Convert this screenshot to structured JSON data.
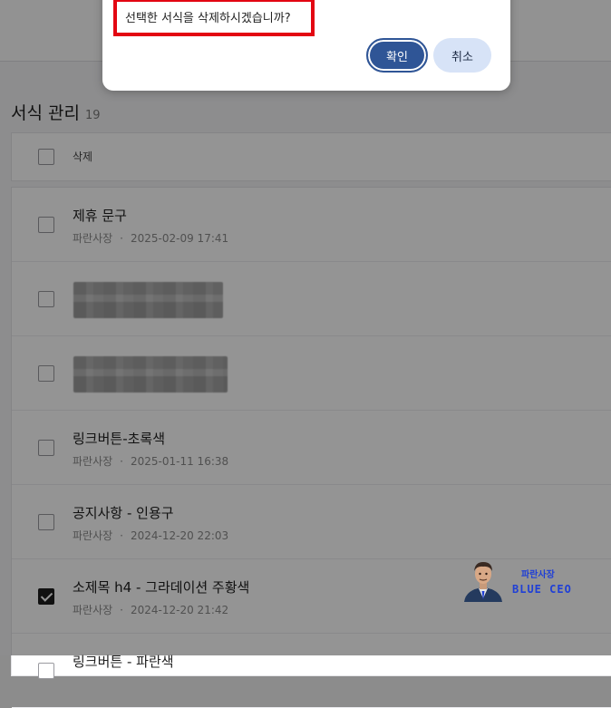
{
  "dialog": {
    "message": "선택한 서식을 삭제하시겠습니까?",
    "confirm_label": "확인",
    "cancel_label": "취소"
  },
  "page": {
    "title": "서식 관리",
    "count": "19"
  },
  "list_header": {
    "delete_label": "삭제"
  },
  "items": [
    {
      "name": "제휴 문구",
      "author": "파란사장",
      "separator": "·",
      "date": "2025-02-09 17:41",
      "checked": false,
      "blurred": false
    },
    {
      "name": "",
      "author": "",
      "separator": "",
      "date": "",
      "checked": false,
      "blurred": true
    },
    {
      "name": "",
      "author": "",
      "separator": "",
      "date": "",
      "checked": false,
      "blurred": true
    },
    {
      "name": "링크버튼-초록색",
      "author": "파란사장",
      "separator": "·",
      "date": "2025-01-11 16:38",
      "checked": false,
      "blurred": false
    },
    {
      "name": "공지사항 - 인용구",
      "author": "파란사장",
      "separator": "·",
      "date": "2024-12-20 22:03",
      "checked": false,
      "blurred": false
    },
    {
      "name": "소제목 h4 - 그라데이션 주황색",
      "author": "파란사장",
      "separator": "·",
      "date": "2024-12-20 21:42",
      "checked": true,
      "blurred": false
    },
    {
      "name": "링크버튼 - 파란색",
      "author": "",
      "separator": "",
      "date": "",
      "checked": false,
      "blurred": false
    }
  ],
  "watermark": {
    "korean": "파란사장",
    "english": "BLUE CEO"
  },
  "colors": {
    "primary": "#2f5596",
    "secondary": "#d7e3f7",
    "highlight_border": "#e30612"
  }
}
